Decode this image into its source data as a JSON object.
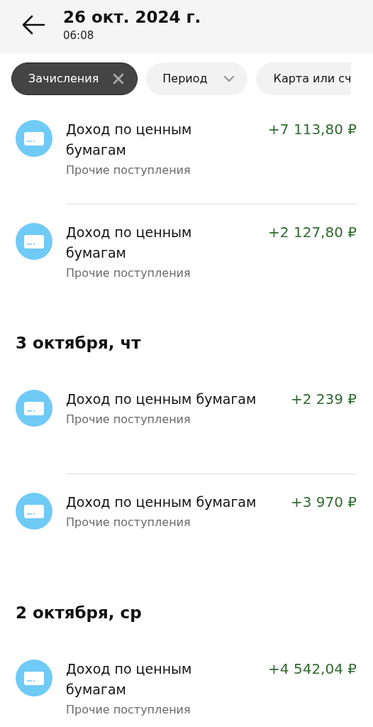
{
  "header": {
    "title": "26 окт. 2024 г.",
    "subtitle": "06:08"
  },
  "filters": [
    {
      "label": "Зачисления",
      "selected": true,
      "kind": "clear"
    },
    {
      "label": "Период",
      "selected": false,
      "kind": "dropdown"
    },
    {
      "label": "Карта или сч",
      "selected": false,
      "kind": "plain"
    }
  ],
  "groups": [
    {
      "transactions": [
        {
          "title": "Доход по ценным бумагам",
          "category": "Прочие поступления",
          "amount": "+7 113,80 ₽",
          "wrap": true
        },
        {
          "title": "Доход по ценным бумагам",
          "category": "Прочие поступления",
          "amount": "+2 127,80 ₽",
          "wrap": true
        }
      ]
    },
    {
      "date": "3 октября, чт",
      "transactions": [
        {
          "title": "Доход по ценным бумагам",
          "category": "Прочие поступления",
          "amount": "+2 239 ₽",
          "wrap": false
        },
        {
          "title": "Доход по ценным бумагам",
          "category": "Прочие поступления",
          "amount": "+3 970 ₽",
          "wrap": false
        }
      ]
    },
    {
      "date": "2 октября, ср",
      "transactions": [
        {
          "title": "Доход по ценным бумагам",
          "category": "Прочие поступления",
          "amount": "+4 542,04 ₽",
          "wrap": true
        }
      ]
    }
  ]
}
